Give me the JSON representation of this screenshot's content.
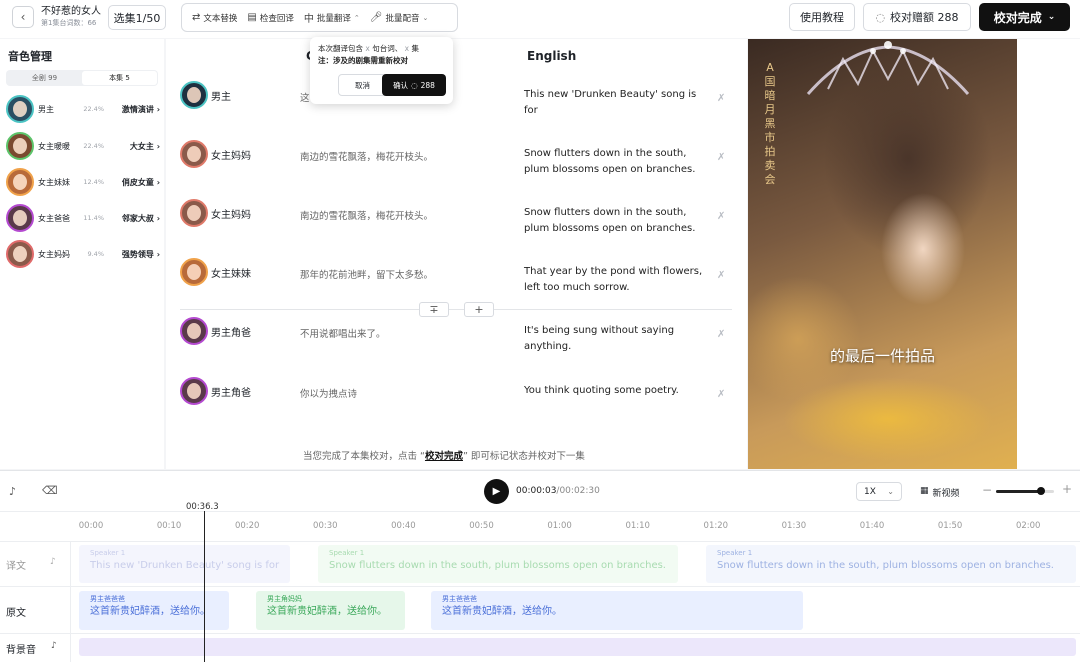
{
  "header": {
    "back_icon": "chevron-left-icon",
    "drama_title": "不好惹的女人",
    "drama_subtitle": "第1集台词数：66",
    "episode_select": "选集1/50",
    "tools": [
      {
        "icon": "replace-icon",
        "label": "文本替换"
      },
      {
        "icon": "check-icon",
        "label": "检查回译"
      },
      {
        "icon": "translate-icon",
        "label": "批量翻译"
      },
      {
        "icon": "mic-icon",
        "label": "批量配音"
      }
    ],
    "tutorial_label": "使用教程",
    "gift_label": "校对赠额 288",
    "done_label": "校对完成"
  },
  "popover": {
    "line1_a": "本次翻译包含",
    "line1_x1": "x",
    "line1_b": "句台词、",
    "line1_x2": "x",
    "line1_c": "集",
    "line2": "注：涉及的剧集需重新校对",
    "cancel_label": "取消",
    "confirm_label": "确认",
    "confirm_amount": "288"
  },
  "voice_panel": {
    "title": "音色管理",
    "tab_all": "全剧 99",
    "tab_episode": "本集 5",
    "items": [
      {
        "name": "男主",
        "pct": "22.4%",
        "style": "激情演讲 ›"
      },
      {
        "name": "女主暖暖",
        "pct": "22.4%",
        "style": "大女主 ›"
      },
      {
        "name": "女主妹妹",
        "pct": "12.4%",
        "style": "俏皮女童 ›"
      },
      {
        "name": "女主爸爸",
        "pct": "11.4%",
        "style": "邻家大叔 ›"
      },
      {
        "name": "女主妈妈",
        "pct": "9.4%",
        "style": "强势领导 ›"
      }
    ]
  },
  "script": {
    "col_source_partial": "C",
    "col_english": "English",
    "rows": [
      {
        "speaker": "男主",
        "source": "这",
        "english": "This new 'Drunken Beauty' song is for"
      },
      {
        "speaker": "女主妈妈",
        "source": "南边的雪花飘落，梅花开枝头。",
        "english": "Snow flutters down in the south, plum blossoms open on branches."
      },
      {
        "speaker": "女主妈妈",
        "source": "南边的雪花飘落，梅花开枝头。",
        "english": "Snow flutters down in the south, plum blossoms open on branches."
      },
      {
        "speaker": "女主妹妹",
        "source": "那年的花前池畔，留下太多愁。",
        "english": "That year by the pond with flowers, left too much sorrow."
      },
      {
        "speaker": "男主角爸",
        "source": "不用说都唱出来了。",
        "english": "It's being sung without saying anything."
      },
      {
        "speaker": "男主角爸",
        "source": "你以为拽点诗",
        "english": "You think quoting some poetry."
      }
    ],
    "hint_before": "当您完成了本集校对，点击 “",
    "hint_link": "校对完成",
    "hint_after": "” 即可标记状态并校对下一集"
  },
  "video": {
    "vertical_text": "A国暗月黑市拍卖会",
    "subtitle": "的最后一件拍品"
  },
  "timeline": {
    "current_time": "00:00:03",
    "total_time": "/00:02:30",
    "speed": "1X",
    "new_video_label": "新视频",
    "zoom_level": 0.78,
    "playhead_label": "00:36.3",
    "ticks": [
      "00:00",
      "00:10",
      "00:20",
      "00:30",
      "00:40",
      "00:50",
      "01:00",
      "01:10",
      "01:20",
      "01:30",
      "01:40",
      "01:50",
      "02:00"
    ],
    "lanes": {
      "translation": "译文",
      "source": "原文",
      "bgm": "背景音"
    },
    "translation_clips": [
      {
        "speaker": "Speaker 1",
        "text": "This new 'Drunken Beauty' song is for"
      },
      {
        "speaker": "Speaker 1",
        "text": "Snow flutters down in the south, plum blossoms open on branches."
      },
      {
        "speaker": "Speaker 1",
        "text": "Snow flutters down in the south, plum blossoms open on branches."
      }
    ],
    "source_clips": [
      {
        "speaker": "男主爸爸爸",
        "text": "这首新贵妃醉酒，送给你。"
      },
      {
        "speaker": "男主角妈妈",
        "text": "这首新贵妃醉酒，送给你。"
      },
      {
        "speaker": "男主爸爸爸",
        "text": "这首新贵妃醉酒，送给你。"
      }
    ]
  }
}
